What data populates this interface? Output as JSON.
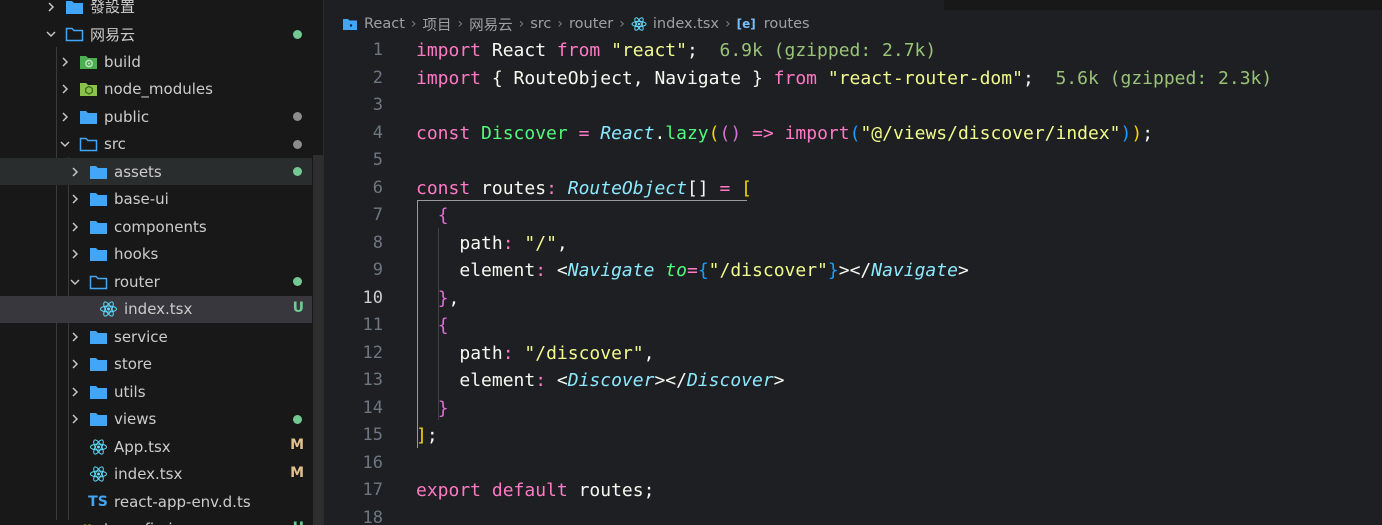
{
  "explorer": {
    "rows": [
      {
        "id": "r0",
        "label": "發設置",
        "depth": 0,
        "kind": "folder-blue",
        "chev": "right",
        "git": ""
      },
      {
        "id": "r1",
        "label": "网易云",
        "depth": 0,
        "kind": "folder-outline",
        "chev": "down",
        "git": "dot-green"
      },
      {
        "id": "r2",
        "label": "build",
        "depth": 1,
        "kind": "folder-build",
        "chev": "right",
        "git": ""
      },
      {
        "id": "r3",
        "label": "node_modules",
        "depth": 1,
        "kind": "folder-node",
        "chev": "right",
        "git": ""
      },
      {
        "id": "r4",
        "label": "public",
        "depth": 1,
        "kind": "folder-blue",
        "chev": "right",
        "git": "dot-gray"
      },
      {
        "id": "r5",
        "label": "src",
        "depth": 1,
        "kind": "folder-outline",
        "chev": "down",
        "git": "dot-gray"
      },
      {
        "id": "r6",
        "label": "assets",
        "depth": 2,
        "kind": "folder-blue",
        "chev": "right",
        "git": "dot-green"
      },
      {
        "id": "r7",
        "label": "base-ui",
        "depth": 2,
        "kind": "folder-blue",
        "chev": "right",
        "git": ""
      },
      {
        "id": "r8",
        "label": "components",
        "depth": 2,
        "kind": "folder-blue",
        "chev": "right",
        "git": ""
      },
      {
        "id": "r9",
        "label": "hooks",
        "depth": 2,
        "kind": "folder-blue",
        "chev": "right",
        "git": ""
      },
      {
        "id": "r10",
        "label": "router",
        "depth": 2,
        "kind": "folder-outline",
        "chev": "down",
        "git": "dot-green"
      },
      {
        "id": "r11",
        "label": "index.tsx",
        "depth": 3,
        "kind": "react",
        "chev": "",
        "git": "U"
      },
      {
        "id": "r12",
        "label": "service",
        "depth": 2,
        "kind": "folder-blue",
        "chev": "right",
        "git": ""
      },
      {
        "id": "r13",
        "label": "store",
        "depth": 2,
        "kind": "folder-blue",
        "chev": "right",
        "git": ""
      },
      {
        "id": "r14",
        "label": "utils",
        "depth": 2,
        "kind": "folder-blue",
        "chev": "right",
        "git": ""
      },
      {
        "id": "r15",
        "label": "views",
        "depth": 2,
        "kind": "folder-blue",
        "chev": "right",
        "git": "dot-green"
      },
      {
        "id": "r16",
        "label": "App.tsx",
        "depth": 2,
        "kind": "react",
        "chev": "",
        "git": "M"
      },
      {
        "id": "r17",
        "label": "index.tsx",
        "depth": 2,
        "kind": "react",
        "chev": "",
        "git": "M"
      },
      {
        "id": "r18",
        "label": "react-app-env.d.ts",
        "depth": 2,
        "kind": "ts",
        "chev": "",
        "git": ""
      },
      {
        "id": "r19",
        "label": "tsconfig.json",
        "depth": 1,
        "kind": "json",
        "chev": "",
        "git": "U"
      }
    ],
    "ts_badge": "TS"
  },
  "breadcrumb": {
    "items": [
      "React",
      "项目",
      "网易云",
      "src",
      "router",
      "index.tsx",
      "routes"
    ],
    "symbol_badge": "[e]"
  },
  "editor": {
    "line_numbers": [
      "1",
      "2",
      "3",
      "4",
      "5",
      "6",
      "7",
      "8",
      "9",
      "10",
      "11",
      "12",
      "13",
      "14",
      "15",
      "16",
      "17",
      "18"
    ],
    "active_line": "10",
    "tokens": {
      "l1": [
        [
          "kw",
          "import"
        ],
        [
          "punc",
          " "
        ],
        [
          "ident",
          "React"
        ],
        [
          "punc",
          " "
        ],
        [
          "kw",
          "from"
        ],
        [
          "punc",
          " "
        ],
        [
          "str",
          "\"react\""
        ],
        [
          "punc",
          ";"
        ],
        [
          "size",
          "  6.9k (gzipped: 2.7k)"
        ]
      ],
      "l2": [
        [
          "kw",
          "import"
        ],
        [
          "punc",
          " { "
        ],
        [
          "ident",
          "RouteObject"
        ],
        [
          "punc",
          ", "
        ],
        [
          "ident",
          "Navigate"
        ],
        [
          "punc",
          " } "
        ],
        [
          "kw",
          "from"
        ],
        [
          "punc",
          " "
        ],
        [
          "str",
          "\"react-router-dom\""
        ],
        [
          "punc",
          ";"
        ],
        [
          "size",
          "  5.6k (gzipped: 2.3k)"
        ]
      ],
      "l3": [],
      "l4": [
        [
          "kw",
          "const"
        ],
        [
          "punc",
          " "
        ],
        [
          "fn",
          "Discover"
        ],
        [
          "punc",
          " "
        ],
        [
          "kw",
          "="
        ],
        [
          "punc",
          " "
        ],
        [
          "cls",
          "React"
        ],
        [
          "punc",
          "."
        ],
        [
          "fn",
          "lazy"
        ],
        [
          "ly",
          "("
        ],
        [
          "lp",
          "()"
        ],
        [
          "punc",
          " "
        ],
        [
          "kw",
          "=>"
        ],
        [
          "punc",
          " "
        ],
        [
          "kw",
          "import"
        ],
        [
          "lb",
          "("
        ],
        [
          "str",
          "\"@/views/discover/index\""
        ],
        [
          "lb",
          ")"
        ],
        [
          "ly",
          ")"
        ],
        [
          "punc",
          ";"
        ]
      ],
      "l5": [],
      "l6": [
        [
          "kw",
          "const"
        ],
        [
          "punc",
          " "
        ],
        [
          "ident",
          "routes"
        ],
        [
          "kw",
          ":"
        ],
        [
          "punc",
          " "
        ],
        [
          "cls",
          "RouteObject"
        ],
        [
          "punc",
          "[] "
        ],
        [
          "kw",
          "="
        ],
        [
          "punc",
          " "
        ],
        [
          "ly",
          "["
        ]
      ],
      "l7": [
        [
          "punc",
          "  "
        ],
        [
          "lp",
          "{"
        ]
      ],
      "l8": [
        [
          "punc",
          "    "
        ],
        [
          "prop",
          "path"
        ],
        [
          "kw",
          ":"
        ],
        [
          "punc",
          " "
        ],
        [
          "str",
          "\"/\""
        ],
        [
          "punc",
          ","
        ]
      ],
      "l9": [
        [
          "punc",
          "    "
        ],
        [
          "prop",
          "element"
        ],
        [
          "kw",
          ":"
        ],
        [
          "punc",
          " <"
        ],
        [
          "cls",
          "Navigate"
        ],
        [
          "punc",
          " "
        ],
        [
          "attr",
          "to"
        ],
        [
          "kw",
          "="
        ],
        [
          "lb",
          "{"
        ],
        [
          "str",
          "\"/discover\""
        ],
        [
          "lb",
          "}"
        ],
        [
          "punc",
          "></"
        ],
        [
          "cls",
          "Navigate"
        ],
        [
          "punc",
          ">"
        ]
      ],
      "l10": [
        [
          "punc",
          "  "
        ],
        [
          "lp",
          "}"
        ],
        [
          "punc",
          ","
        ]
      ],
      "l11": [
        [
          "punc",
          "  "
        ],
        [
          "lp",
          "{"
        ]
      ],
      "l12": [
        [
          "punc",
          "    "
        ],
        [
          "prop",
          "path"
        ],
        [
          "kw",
          ":"
        ],
        [
          "punc",
          " "
        ],
        [
          "str",
          "\"/discover\""
        ],
        [
          "punc",
          ","
        ]
      ],
      "l13": [
        [
          "punc",
          "    "
        ],
        [
          "prop",
          "element"
        ],
        [
          "kw",
          ":"
        ],
        [
          "punc",
          " <"
        ],
        [
          "cls",
          "Discover"
        ],
        [
          "punc",
          "></"
        ],
        [
          "cls",
          "Discover"
        ],
        [
          "punc",
          ">"
        ]
      ],
      "l14": [
        [
          "punc",
          "  "
        ],
        [
          "lp",
          "}"
        ]
      ],
      "l15": [
        [
          "ly",
          "]"
        ],
        [
          "punc",
          ";"
        ]
      ],
      "l16": [],
      "l17": [
        [
          "kw",
          "export"
        ],
        [
          "punc",
          " "
        ],
        [
          "kw",
          "default"
        ],
        [
          "punc",
          " "
        ],
        [
          "ident",
          "routes"
        ],
        [
          "punc",
          ";"
        ]
      ],
      "l18": []
    }
  },
  "colors": {
    "git_green": "#73c991",
    "git_gray": "#8c8c8c",
    "git_modified": "#e2c08d",
    "git_untracked": "#73c991",
    "folder_blue": "#42a5f5",
    "react_blue": "#61dafb"
  }
}
